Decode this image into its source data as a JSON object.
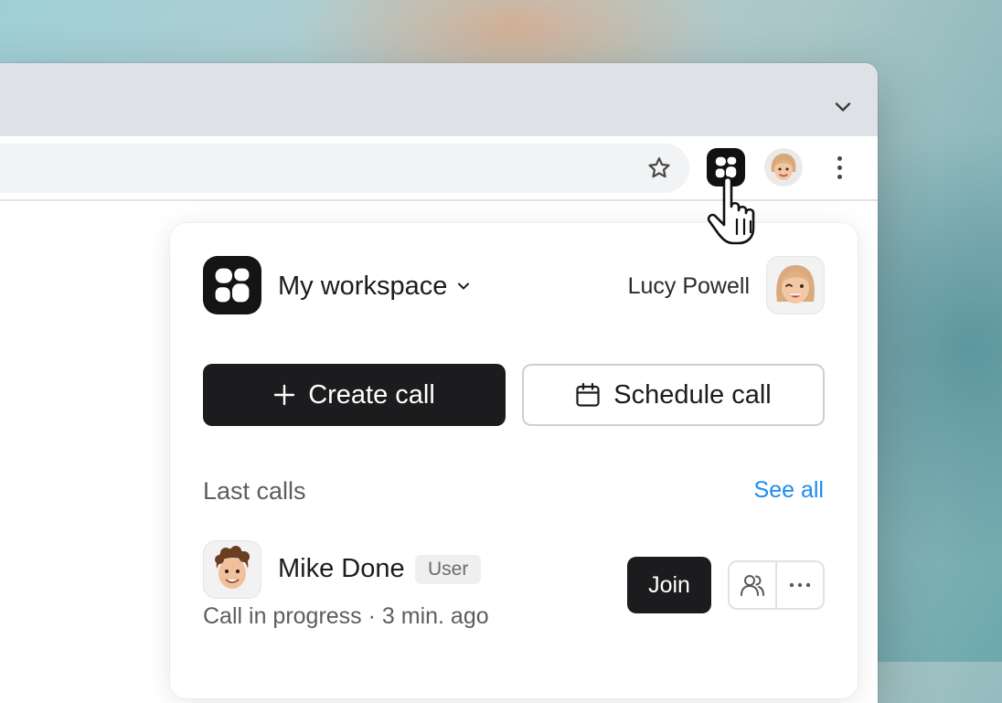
{
  "browser": {
    "tab_dropdown_icon": "chevron-down-icon",
    "toolbar": {
      "bookmark_icon": "star-icon",
      "extension_icon": "extension-logo-icon",
      "profile_icon": "profile-avatar",
      "menu_icon": "kebab-menu-icon"
    }
  },
  "popup": {
    "workspace": {
      "name": "My workspace",
      "dropdown_icon": "chevron-down-icon"
    },
    "user": {
      "name": "Lucy Powell"
    },
    "actions": {
      "create_label": "Create call",
      "create_icon": "plus-icon",
      "schedule_label": "Schedule call",
      "schedule_icon": "calendar-icon"
    },
    "last_calls": {
      "title": "Last calls",
      "see_all": "See all",
      "items": [
        {
          "name": "Mike Done",
          "role": "User",
          "status": "Call in progress · 3 min. ago",
          "join_label": "Join",
          "participants_icon": "users-icon",
          "more_icon": "more-horizontal-icon"
        }
      ]
    }
  },
  "colors": {
    "primary_dark": "#1c1c1e",
    "link_blue": "#1a8cf0",
    "tabstrip": "#dee1e6"
  }
}
